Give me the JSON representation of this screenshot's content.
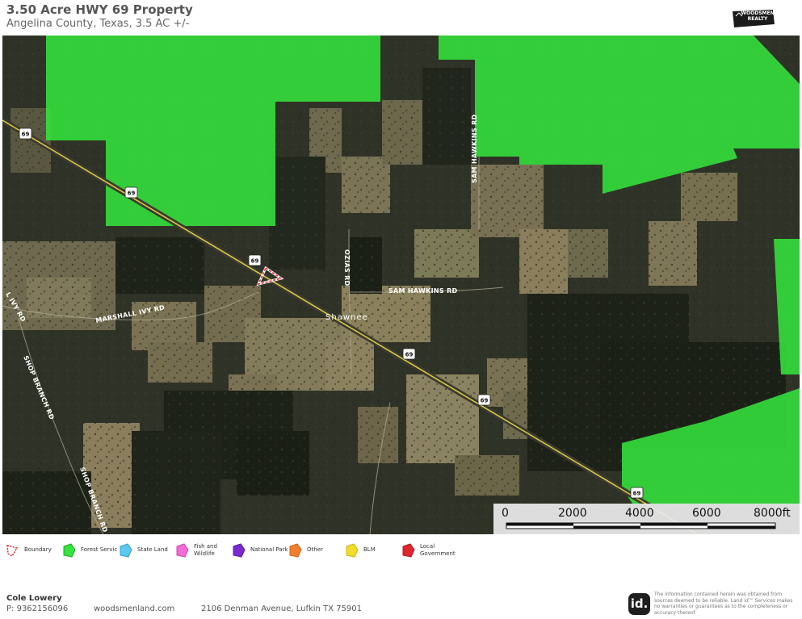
{
  "header": {
    "title": "3.50 Acre HWY 69 Property",
    "subtitle": "Angelina County, Texas, 3.5 AC +/-",
    "brand_logo": "WOODSMEN REALTY"
  },
  "map": {
    "roads": {
      "sam_hawkins_vertical": "SAM HAWKINS RD",
      "sam_hawkins_horizontal": "SAM HAWKINS RD",
      "ozias": "OZIAS RD",
      "marshall_ivy": "MARSHALL IVY RD",
      "ivy_rd_partial": "L IVY RD",
      "shop_branch_upper": "SHOP BRANCH RD",
      "shop_branch_lower": "SHOP BRANCH RD"
    },
    "place": "Shawnee",
    "highway_shield": "69",
    "colors": {
      "forest_service": "#35e23e",
      "boundary": "#e0252f",
      "imagery_dark": "#2f3327",
      "highway_line": "#d9c640"
    }
  },
  "scale_bar": {
    "labels": [
      "0",
      "2000",
      "4000",
      "6000",
      "8000ft"
    ]
  },
  "legend": {
    "items": [
      {
        "label": "Boundary",
        "color": "#e0252f",
        "icon": "boundary-outline-icon"
      },
      {
        "label": "Forest Servic",
        "color": "#35e23e",
        "icon": "forest-service-swatch-icon"
      },
      {
        "label": "State Land",
        "color": "#5bc8f0",
        "icon": "state-land-swatch-icon"
      },
      {
        "label": "Fish and Wildlife",
        "color": "#f06cd7",
        "icon": "fish-wildlife-swatch-icon"
      },
      {
        "label": "National Park",
        "color": "#7a2ad0",
        "icon": "national-park-swatch-icon"
      },
      {
        "label": "Other",
        "color": "#f08030",
        "icon": "other-swatch-icon"
      },
      {
        "label": "BLM",
        "color": "#f2dc2a",
        "icon": "blm-swatch-icon"
      },
      {
        "label": "Local Government",
        "color": "#e0252f",
        "icon": "local-government-swatch-icon"
      }
    ]
  },
  "footer": {
    "agent_name": "Cole Lowery",
    "agent_phone": "P: 9362156096",
    "website": "woodsmenland.com",
    "address": "2106 Denman Avenue, Lufkin TX 75901",
    "id_logo": "id.",
    "disclaimer": "The information contained herein was obtained from sources deemed to be reliable. Land id™ Services makes no warranties or guarantees as to the completeness or accuracy thereof."
  }
}
